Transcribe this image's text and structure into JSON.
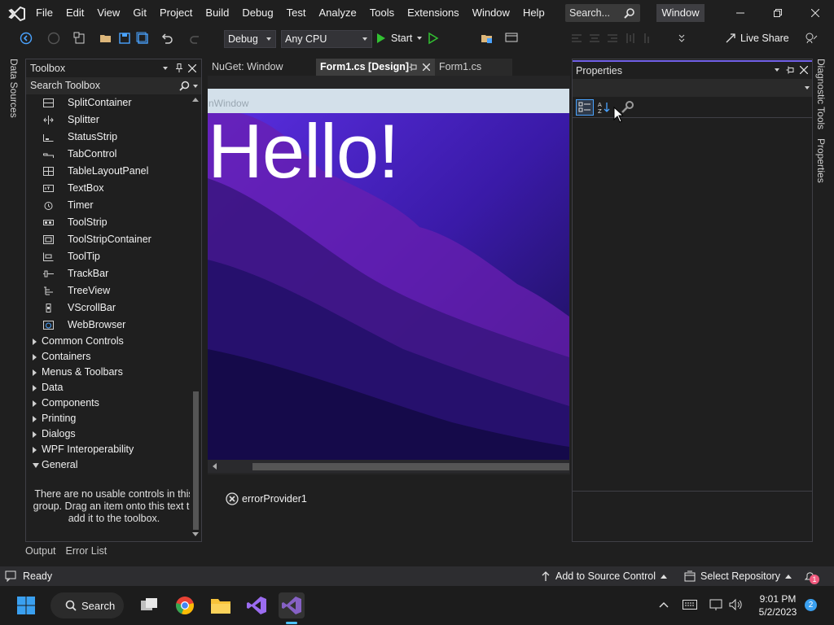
{
  "app": {
    "menu": [
      "File",
      "Edit",
      "View",
      "Git",
      "Project",
      "Build",
      "Debug",
      "Test",
      "Analyze",
      "Tools",
      "Extensions",
      "Window",
      "Help"
    ],
    "search_placeholder": "Search...",
    "solution_name": "Window"
  },
  "toolbar": {
    "config": "Debug",
    "platform": "Any CPU",
    "start_label": "Start",
    "live_share": "Live Share"
  },
  "left_strip": {
    "data_sources": "Data Sources"
  },
  "toolbox": {
    "title": "Toolbox",
    "search_placeholder": "Search Toolbox",
    "items": [
      "SplitContainer",
      "Splitter",
      "StatusStrip",
      "TabControl",
      "TableLayoutPanel",
      "TextBox",
      "Timer",
      "ToolStrip",
      "ToolStripContainer",
      "ToolTip",
      "TrackBar",
      "TreeView",
      "VScrollBar",
      "WebBrowser"
    ],
    "groups": [
      "Common Controls",
      "Containers",
      "Menus & Toolbars",
      "Data",
      "Components",
      "Printing",
      "Dialogs",
      "WPF Interoperability",
      "General"
    ],
    "empty_message": "There are no usable controls in this group. Drag an item onto this text to add it to the toolbox."
  },
  "document": {
    "tabs": [
      "NuGet: Window",
      "Form1.cs [Design]",
      "Form1.cs"
    ],
    "form_title": "nWindow",
    "hello_text": "Hello!",
    "tray_component": "errorProvider1"
  },
  "properties": {
    "title": "Properties"
  },
  "right_strip": {
    "diagnostic_tools": "Diagnostic Tools",
    "properties": "Properties"
  },
  "bottom_tabs": [
    "Output",
    "Error List"
  ],
  "status": {
    "ready": "Ready",
    "source_control": "Add to Source Control",
    "repository": "Select Repository",
    "notifications": "1"
  },
  "taskbar": {
    "search_label": "Search",
    "time": "9:01 PM",
    "date": "5/2/2023",
    "notification_count": "2"
  },
  "colors": {
    "accent": "#7160e8",
    "chrome": "#1f1f1f",
    "form_caption": "#d3e0ea"
  }
}
